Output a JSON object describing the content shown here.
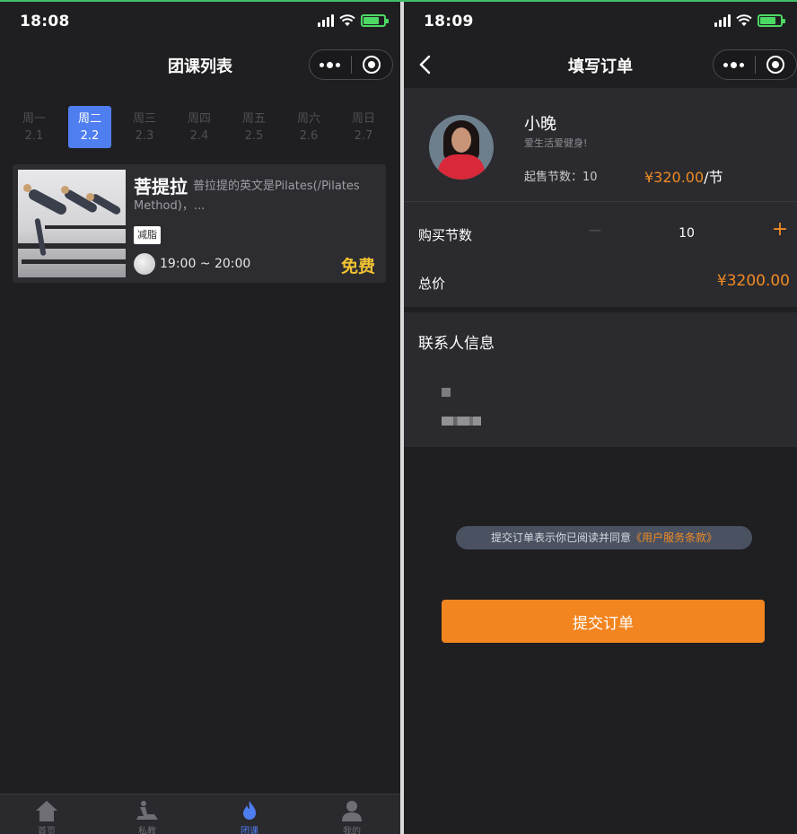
{
  "left": {
    "status": {
      "time": "18:08"
    },
    "nav": {
      "title": "团课列表"
    },
    "week": [
      {
        "day": "周一",
        "date": "2.1",
        "active": false
      },
      {
        "day": "周二",
        "date": "2.2",
        "active": true
      },
      {
        "day": "周三",
        "date": "2.3",
        "active": false
      },
      {
        "day": "周四",
        "date": "2.4",
        "active": false
      },
      {
        "day": "周五",
        "date": "2.5",
        "active": false
      },
      {
        "day": "周六",
        "date": "2.6",
        "active": false
      },
      {
        "day": "周日",
        "date": "2.7",
        "active": false
      }
    ],
    "course": {
      "title": "菩提拉",
      "description": "普拉提的英文是Pilates(/Pilates Method)，...",
      "tag": "减脂",
      "time": "19:00 ~ 20:00",
      "price": "免费"
    },
    "tabs": [
      {
        "label": "首页",
        "icon": "home-icon",
        "active": false
      },
      {
        "label": "私教",
        "icon": "treadmill-icon",
        "active": false
      },
      {
        "label": "团课",
        "icon": "flame-icon",
        "active": true
      },
      {
        "label": "我的",
        "icon": "user-icon",
        "active": false
      }
    ]
  },
  "right": {
    "status": {
      "time": "18:09"
    },
    "nav": {
      "title": "填写订单"
    },
    "coach": {
      "name": "小晚",
      "subtitle": "爱生活爱健身!",
      "min_label": "起售节数：10",
      "price": "¥320.00",
      "price_unit": "/节"
    },
    "purchase": {
      "label": "购买节数",
      "minus": "−",
      "quantity": "10",
      "plus": "+",
      "total_label": "总价",
      "total": "¥3200.00"
    },
    "contact": {
      "title": "联系人信息"
    },
    "agreement": {
      "text": "提交订单表示你已阅读并同意",
      "link": "《用户服务条款》"
    },
    "submit_label": "提交订单"
  },
  "colors": {
    "accent_blue": "#4f7ef0",
    "accent_orange": "#f28520",
    "price_yellow": "#f1c232",
    "background": "#1f1f22",
    "card": "#2b2b2f"
  }
}
